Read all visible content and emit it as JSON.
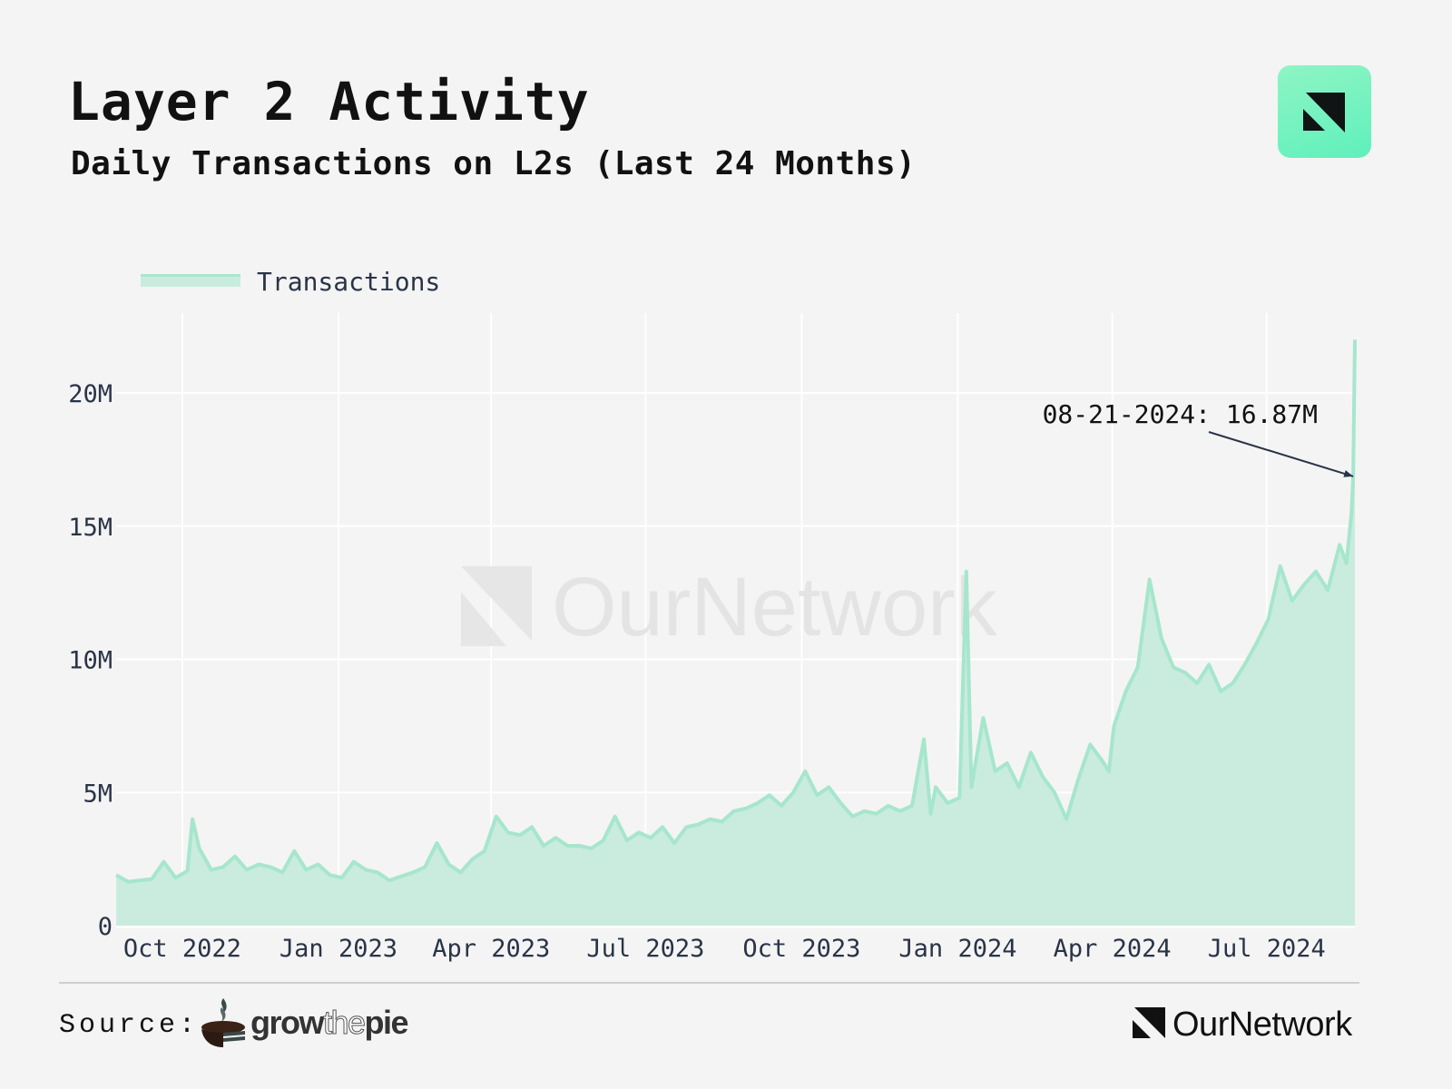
{
  "header": {
    "title": "Layer 2 Activity",
    "subtitle": "Daily Transactions on L2s (Last 24 Months)",
    "logo_icon": "ournetwork-logo-icon"
  },
  "watermark": {
    "text": "OurNetwork"
  },
  "footer": {
    "source_label": "Source:",
    "source_brand_parts": [
      "grow",
      "the",
      "pie"
    ],
    "brand_text": "OurNetwork"
  },
  "colors": {
    "background": "#f4f4f4",
    "series_line": "#a6e6cd",
    "series_fill": "#c9ecdf",
    "grid": "#ffffff",
    "axis_text": "#2a3447",
    "annotation": "#2a3447",
    "logo_badge": "#6ff2bf"
  },
  "chart_data": {
    "type": "area",
    "title": "Layer 2 Activity",
    "subtitle": "Daily Transactions on L2s (Last 24 Months)",
    "xlabel": "",
    "ylabel": "",
    "legend": {
      "entries": [
        "Transactions"
      ],
      "placement": "top-left"
    },
    "grid": true,
    "xlim": [
      "2022-08-23",
      "2024-08-22"
    ],
    "ylim": [
      0,
      23000000
    ],
    "y_ticks": [
      0,
      5000000,
      10000000,
      15000000,
      20000000
    ],
    "y_tick_labels": [
      "0",
      "5M",
      "10M",
      "15M",
      "20M"
    ],
    "x_ticks": [
      "2022-10-01",
      "2023-01-01",
      "2023-04-01",
      "2023-07-01",
      "2023-10-01",
      "2024-01-01",
      "2024-04-01",
      "2024-07-01"
    ],
    "x_tick_labels": [
      "Oct 2022",
      "Jan 2023",
      "Apr 2023",
      "Jul 2023",
      "Oct 2023",
      "Jan 2024",
      "Apr 2024",
      "Jul 2024"
    ],
    "annotation": {
      "x": "2024-08-21",
      "y": 16870000,
      "text": "08-21-2024: 16.87M"
    },
    "series": [
      {
        "name": "Transactions",
        "x": [
          "2022-08-23",
          "2022-08-30",
          "2022-09-06",
          "2022-09-13",
          "2022-09-20",
          "2022-09-27",
          "2022-10-04",
          "2022-10-07",
          "2022-10-11",
          "2022-10-18",
          "2022-10-25",
          "2022-11-01",
          "2022-11-08",
          "2022-11-15",
          "2022-11-22",
          "2022-11-29",
          "2022-12-06",
          "2022-12-13",
          "2022-12-20",
          "2022-12-27",
          "2023-01-03",
          "2023-01-10",
          "2023-01-17",
          "2023-01-24",
          "2023-01-31",
          "2023-02-07",
          "2023-02-14",
          "2023-02-21",
          "2023-02-28",
          "2023-03-07",
          "2023-03-14",
          "2023-03-21",
          "2023-03-28",
          "2023-04-04",
          "2023-04-11",
          "2023-04-18",
          "2023-04-25",
          "2023-05-02",
          "2023-05-09",
          "2023-05-16",
          "2023-05-23",
          "2023-05-30",
          "2023-06-06",
          "2023-06-13",
          "2023-06-20",
          "2023-06-27",
          "2023-07-04",
          "2023-07-11",
          "2023-07-18",
          "2023-07-25",
          "2023-08-01",
          "2023-08-08",
          "2023-08-15",
          "2023-08-22",
          "2023-08-29",
          "2023-09-05",
          "2023-09-12",
          "2023-09-19",
          "2023-09-26",
          "2023-10-03",
          "2023-10-10",
          "2023-10-17",
          "2023-10-24",
          "2023-10-31",
          "2023-11-07",
          "2023-11-14",
          "2023-11-21",
          "2023-11-28",
          "2023-12-05",
          "2023-12-12",
          "2023-12-16",
          "2023-12-19",
          "2023-12-26",
          "2024-01-02",
          "2024-01-06",
          "2024-01-09",
          "2024-01-16",
          "2024-01-23",
          "2024-01-30",
          "2024-02-06",
          "2024-02-13",
          "2024-02-20",
          "2024-02-27",
          "2024-03-05",
          "2024-03-12",
          "2024-03-19",
          "2024-03-26",
          "2024-03-30",
          "2024-04-02",
          "2024-04-09",
          "2024-04-16",
          "2024-04-23",
          "2024-04-30",
          "2024-05-07",
          "2024-05-14",
          "2024-05-21",
          "2024-05-28",
          "2024-06-04",
          "2024-06-11",
          "2024-06-18",
          "2024-06-25",
          "2024-07-02",
          "2024-07-09",
          "2024-07-16",
          "2024-07-23",
          "2024-07-30",
          "2024-08-06",
          "2024-08-13",
          "2024-08-17",
          "2024-08-20",
          "2024-08-21",
          "2024-08-22"
        ],
        "values": [
          1900000,
          1650000,
          1700000,
          1750000,
          2400000,
          1800000,
          2050000,
          4000000,
          2900000,
          2100000,
          2200000,
          2600000,
          2100000,
          2300000,
          2200000,
          2000000,
          2800000,
          2100000,
          2300000,
          1900000,
          1800000,
          2400000,
          2100000,
          2000000,
          1700000,
          1850000,
          2000000,
          2200000,
          3100000,
          2300000,
          2000000,
          2500000,
          2800000,
          4100000,
          3500000,
          3400000,
          3700000,
          3000000,
          3300000,
          3000000,
          3000000,
          2900000,
          3200000,
          4100000,
          3200000,
          3500000,
          3300000,
          3700000,
          3100000,
          3700000,
          3800000,
          4000000,
          3900000,
          4300000,
          4400000,
          4600000,
          4900000,
          4500000,
          5000000,
          5800000,
          4900000,
          5200000,
          4600000,
          4100000,
          4300000,
          4200000,
          4500000,
          4300000,
          4500000,
          7000000,
          4200000,
          5200000,
          4600000,
          4800000,
          13300000,
          5200000,
          7800000,
          5800000,
          6100000,
          5200000,
          6500000,
          5600000,
          5000000,
          4000000,
          5500000,
          6800000,
          6200000,
          5800000,
          7500000,
          8800000,
          9700000,
          13000000,
          10800000,
          9700000,
          9500000,
          9100000,
          9800000,
          8800000,
          9100000,
          9800000,
          10600000,
          11500000,
          13500000,
          12200000,
          12800000,
          13300000,
          12600000,
          14300000,
          13600000,
          15500000,
          16870000,
          22000000
        ]
      }
    ]
  }
}
